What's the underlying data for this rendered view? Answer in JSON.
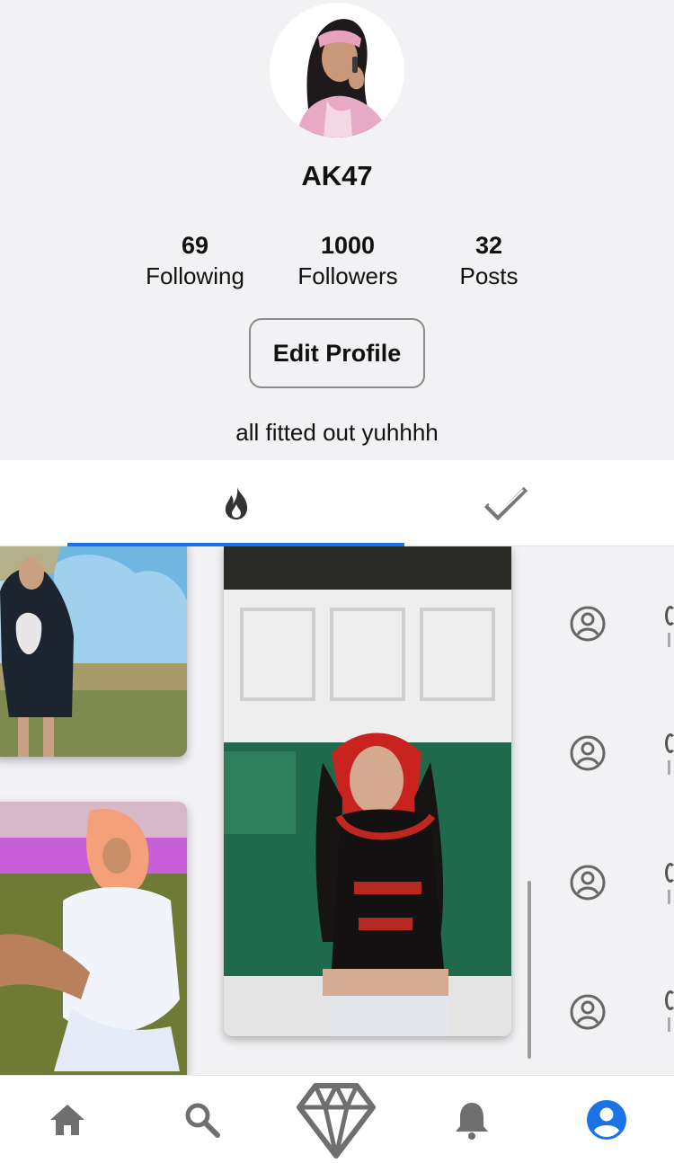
{
  "profile": {
    "username": "AK47",
    "bio": "all fitted out yuhhhh",
    "avatar_icon": "profile-photo"
  },
  "stats": {
    "following": {
      "value": "69",
      "label": "Following"
    },
    "followers": {
      "value": "1000",
      "label": "Followers"
    },
    "posts": {
      "value": "32",
      "label": "Posts"
    }
  },
  "buttons": {
    "edit_profile": "Edit Profile"
  },
  "tabs": [
    {
      "icon": "fire-icon",
      "active": true
    },
    {
      "icon": "checkmark-icon",
      "active": false
    }
  ],
  "posts": [
    {
      "icon": "photo-thumbnail"
    },
    {
      "icon": "photo-thumbnail"
    },
    {
      "icon": "photo-thumbnail"
    }
  ],
  "list": [
    {
      "icon": "user-circle-icon"
    },
    {
      "icon": "user-circle-icon"
    },
    {
      "icon": "user-circle-icon"
    },
    {
      "icon": "user-circle-icon"
    }
  ],
  "bottom_nav": [
    {
      "icon": "home-icon",
      "active": false
    },
    {
      "icon": "search-icon",
      "active": false
    },
    {
      "icon": "diamond-icon",
      "active": false
    },
    {
      "icon": "bell-icon",
      "active": false
    },
    {
      "icon": "account-icon",
      "active": true
    }
  ],
  "colors": {
    "accent": "#1b73e8",
    "background": "#f2f1f3",
    "icon_gray": "#6f6f6f"
  }
}
